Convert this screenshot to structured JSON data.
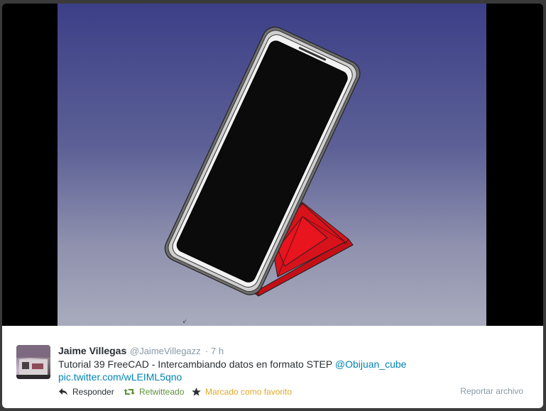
{
  "viewer": {
    "scene_description_icon": "freecad-3d-viewport"
  },
  "tweet": {
    "author_name": "Jaime Villegas",
    "author_handle": "@JaimeVillegazz",
    "separator": "·",
    "time": "7 h",
    "text": "Tutorial 39 FreeCAD - Intercambiando datos en formato STEP ",
    "mention": "@Obijuan_cube",
    "link": "pic.twitter.com/wLEIML5qno"
  },
  "actions": {
    "reply_label": "Responder",
    "retweet_label": "Retwitteado",
    "favorite_label": "Marcado como favorito",
    "report_label": "Reportar archivo"
  },
  "colors": {
    "retweet_active": "#5c913b",
    "favorite_active": "#e3a82b",
    "link": "#0084b4",
    "stand": "#d8121b"
  }
}
